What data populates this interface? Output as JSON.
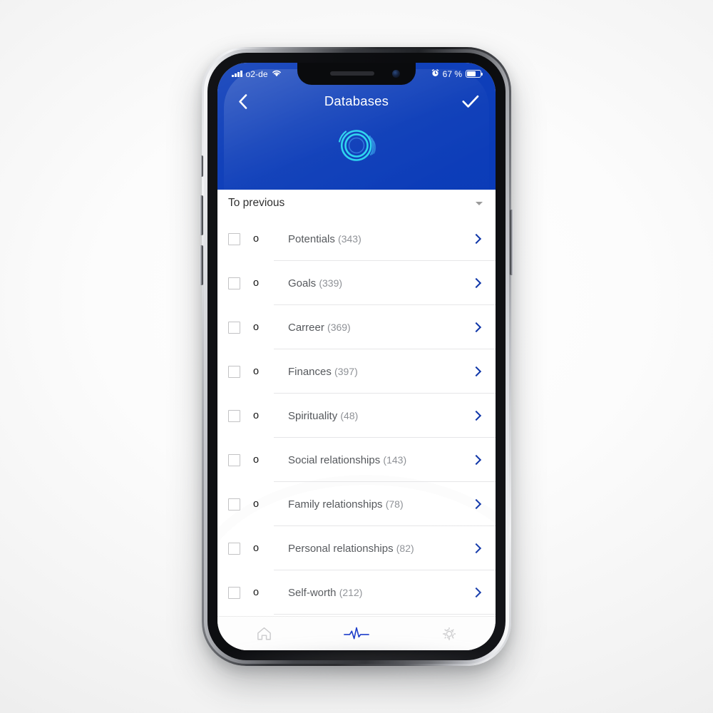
{
  "device": {
    "name": "smartphone-mockup"
  },
  "statusbar": {
    "carrier": "o2-de",
    "signal_icon": "signal-bars-icon",
    "wifi_icon": "wifi-icon",
    "alarm_icon": "alarm-clock-icon",
    "battery_percent": "67 %",
    "battery_icon": "battery-icon",
    "battery_level": 67
  },
  "navbar": {
    "back_icon": "chevron-left-icon",
    "title": "Databases",
    "confirm_icon": "checkmark-icon"
  },
  "branding": {
    "logo_icon": "concentric-spiral-logo-icon",
    "logo_color": "#29d7f2",
    "header_color": "#0a3bb8"
  },
  "list": {
    "group_header": "To previous",
    "group_caret_icon": "caret-down-icon",
    "bullet_marker": "o",
    "chevron_icon": "chevron-right-icon",
    "chevron_color": "#0e35a8",
    "items": [
      {
        "label": "Potentials",
        "count": "(343)"
      },
      {
        "label": "Goals",
        "count": "(339)"
      },
      {
        "label": "Carreer",
        "count": "(369)"
      },
      {
        "label": "Finances",
        "count": "(397)"
      },
      {
        "label": "Spirituality",
        "count": "(48)"
      },
      {
        "label": "Social relationships",
        "count": "(143)"
      },
      {
        "label": "Family relationships",
        "count": "(78)"
      },
      {
        "label": "Personal relationships",
        "count": "(82)"
      },
      {
        "label": "Self-worth",
        "count": "(212)"
      }
    ]
  },
  "tabbar": {
    "items": [
      {
        "icon": "home-icon",
        "active": false
      },
      {
        "icon": "pulse-icon",
        "active": true
      },
      {
        "icon": "settings-gear-icon",
        "active": false
      }
    ],
    "active_color": "#1234c8",
    "inactive_color": "#c9c9cb"
  }
}
